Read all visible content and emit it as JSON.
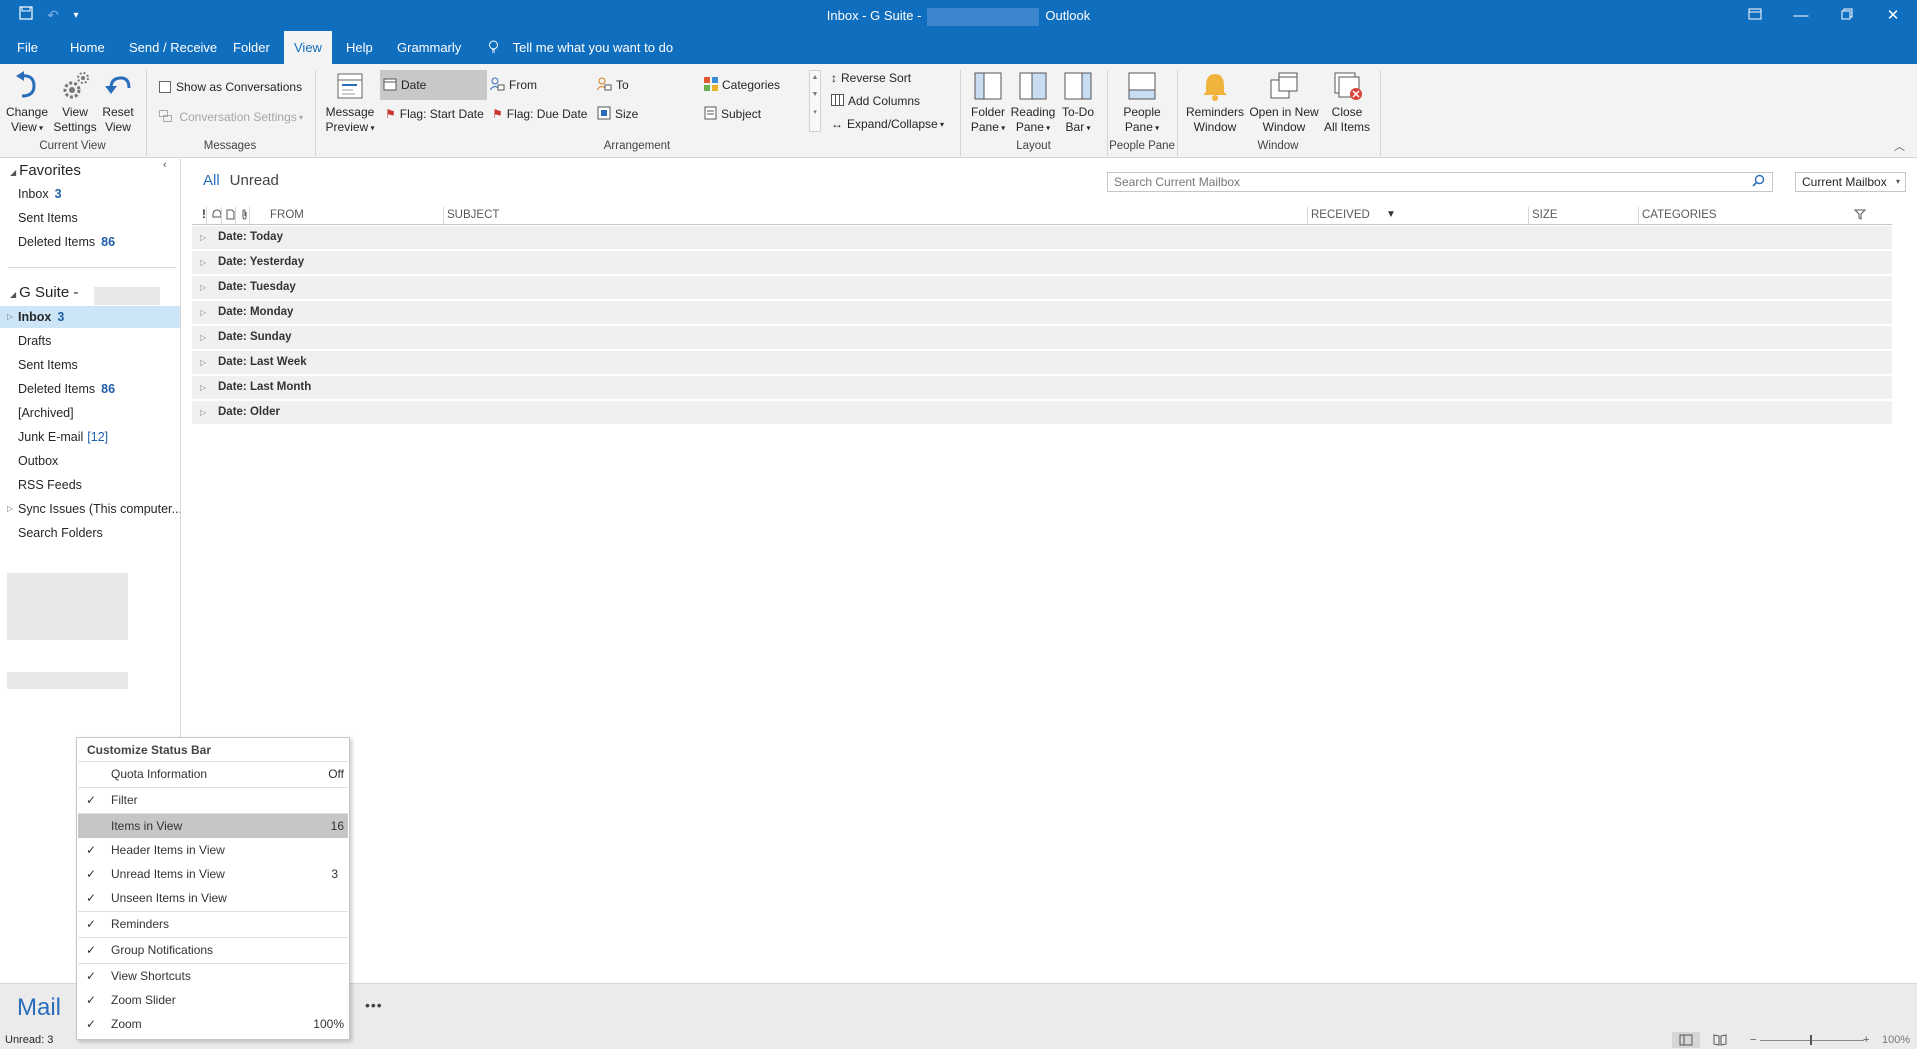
{
  "titlebar": {
    "prefix": "Inbox - G Suite -",
    "app": "Outlook",
    "undo": "↶",
    "customize": "▾"
  },
  "menu": [
    {
      "label": "File"
    },
    {
      "label": "Home"
    },
    {
      "label": "Send / Receive"
    },
    {
      "label": "Folder"
    },
    {
      "label": "View",
      "active": true
    },
    {
      "label": "Help"
    },
    {
      "label": "Grammarly"
    }
  ],
  "tellme": "Tell me what you want to do",
  "ribbon": {
    "current_view": {
      "change": [
        "Change",
        "View"
      ],
      "settings": [
        "View",
        "Settings"
      ],
      "reset": [
        "Reset",
        "View"
      ],
      "group": "Current View"
    },
    "messages": {
      "show_conv": "Show as Conversations",
      "conv_settings": "Conversation Settings",
      "group": "Messages"
    },
    "preview": [
      "Message",
      "Preview"
    ],
    "arrangement": {
      "items": [
        "Date",
        "From",
        "To",
        "Categories",
        "Flag: Start Date",
        "Flag: Due Date",
        "Size",
        "Subject"
      ],
      "reverse_sort": "Reverse Sort",
      "add_columns": "Add Columns",
      "expand": "Expand/Collapse",
      "group": "Arrangement"
    },
    "layout": {
      "folder": [
        "Folder",
        "Pane"
      ],
      "reading": [
        "Reading",
        "Pane"
      ],
      "todo": [
        "To-Do",
        "Bar"
      ],
      "group": "Layout"
    },
    "people": {
      "btn": [
        "People",
        "Pane"
      ],
      "group": "People Pane"
    },
    "window": {
      "reminders": [
        "Reminders",
        "Window"
      ],
      "open_new": [
        "Open in New",
        "Window"
      ],
      "close_all": [
        "Close",
        "All Items"
      ],
      "group": "Window"
    }
  },
  "favorites": {
    "title": "Favorites",
    "items": [
      {
        "label": "Inbox",
        "count": "3"
      },
      {
        "label": "Sent Items",
        "count": ""
      },
      {
        "label": "Deleted Items",
        "count": "86"
      }
    ]
  },
  "account": {
    "title": "G Suite -",
    "items": [
      {
        "label": "Inbox",
        "count": "3"
      },
      {
        "label": "Drafts",
        "count": ""
      },
      {
        "label": "Sent Items",
        "count": ""
      },
      {
        "label": "Deleted Items",
        "count": "86"
      },
      {
        "label": "[Archived]",
        "count": ""
      },
      {
        "label": "Junk E-mail",
        "count": "[12]"
      },
      {
        "label": "Outbox",
        "count": ""
      },
      {
        "label": "RSS Feeds",
        "count": ""
      },
      {
        "label": "Sync Issues (This computer...",
        "count": ""
      },
      {
        "label": "Search Folders",
        "count": ""
      }
    ]
  },
  "view_tabs": {
    "all": "All",
    "unread": "Unread"
  },
  "search": {
    "placeholder": "Search Current Mailbox",
    "scope": "Current Mailbox"
  },
  "columns": {
    "from": "FROM",
    "subject": "SUBJECT",
    "received": "RECEIVED",
    "size": "SIZE",
    "categories": "CATEGORIES"
  },
  "groups": [
    "Date: Today",
    "Date: Yesterday",
    "Date: Tuesday",
    "Date: Monday",
    "Date: Sunday",
    "Date: Last Week",
    "Date: Last Month",
    "Date: Older"
  ],
  "nav": {
    "mail": "Mail",
    "more": "•••"
  },
  "status": {
    "unread": "Unread: 3",
    "zoom": "100%"
  },
  "context_menu": {
    "title": "Customize Status Bar",
    "items": [
      {
        "label": "Quota Information",
        "value": "Off",
        "checked": false
      },
      {
        "label": "Filter",
        "value": "",
        "checked": true
      },
      {
        "label": "Items in View",
        "value": "16",
        "checked": false
      },
      {
        "label": "Header Items in View",
        "value": "",
        "checked": true
      },
      {
        "label": "Unread Items in View",
        "value": "3",
        "checked": true
      },
      {
        "label": "Unseen Items in View",
        "value": "",
        "checked": true
      },
      {
        "label": "Reminders",
        "value": "",
        "checked": true
      },
      {
        "label": "Group Notifications",
        "value": "",
        "checked": true
      },
      {
        "label": "View Shortcuts",
        "value": "",
        "checked": true
      },
      {
        "label": "Zoom Slider",
        "value": "",
        "checked": true
      },
      {
        "label": "Zoom",
        "value": "100%",
        "checked": true
      }
    ]
  }
}
